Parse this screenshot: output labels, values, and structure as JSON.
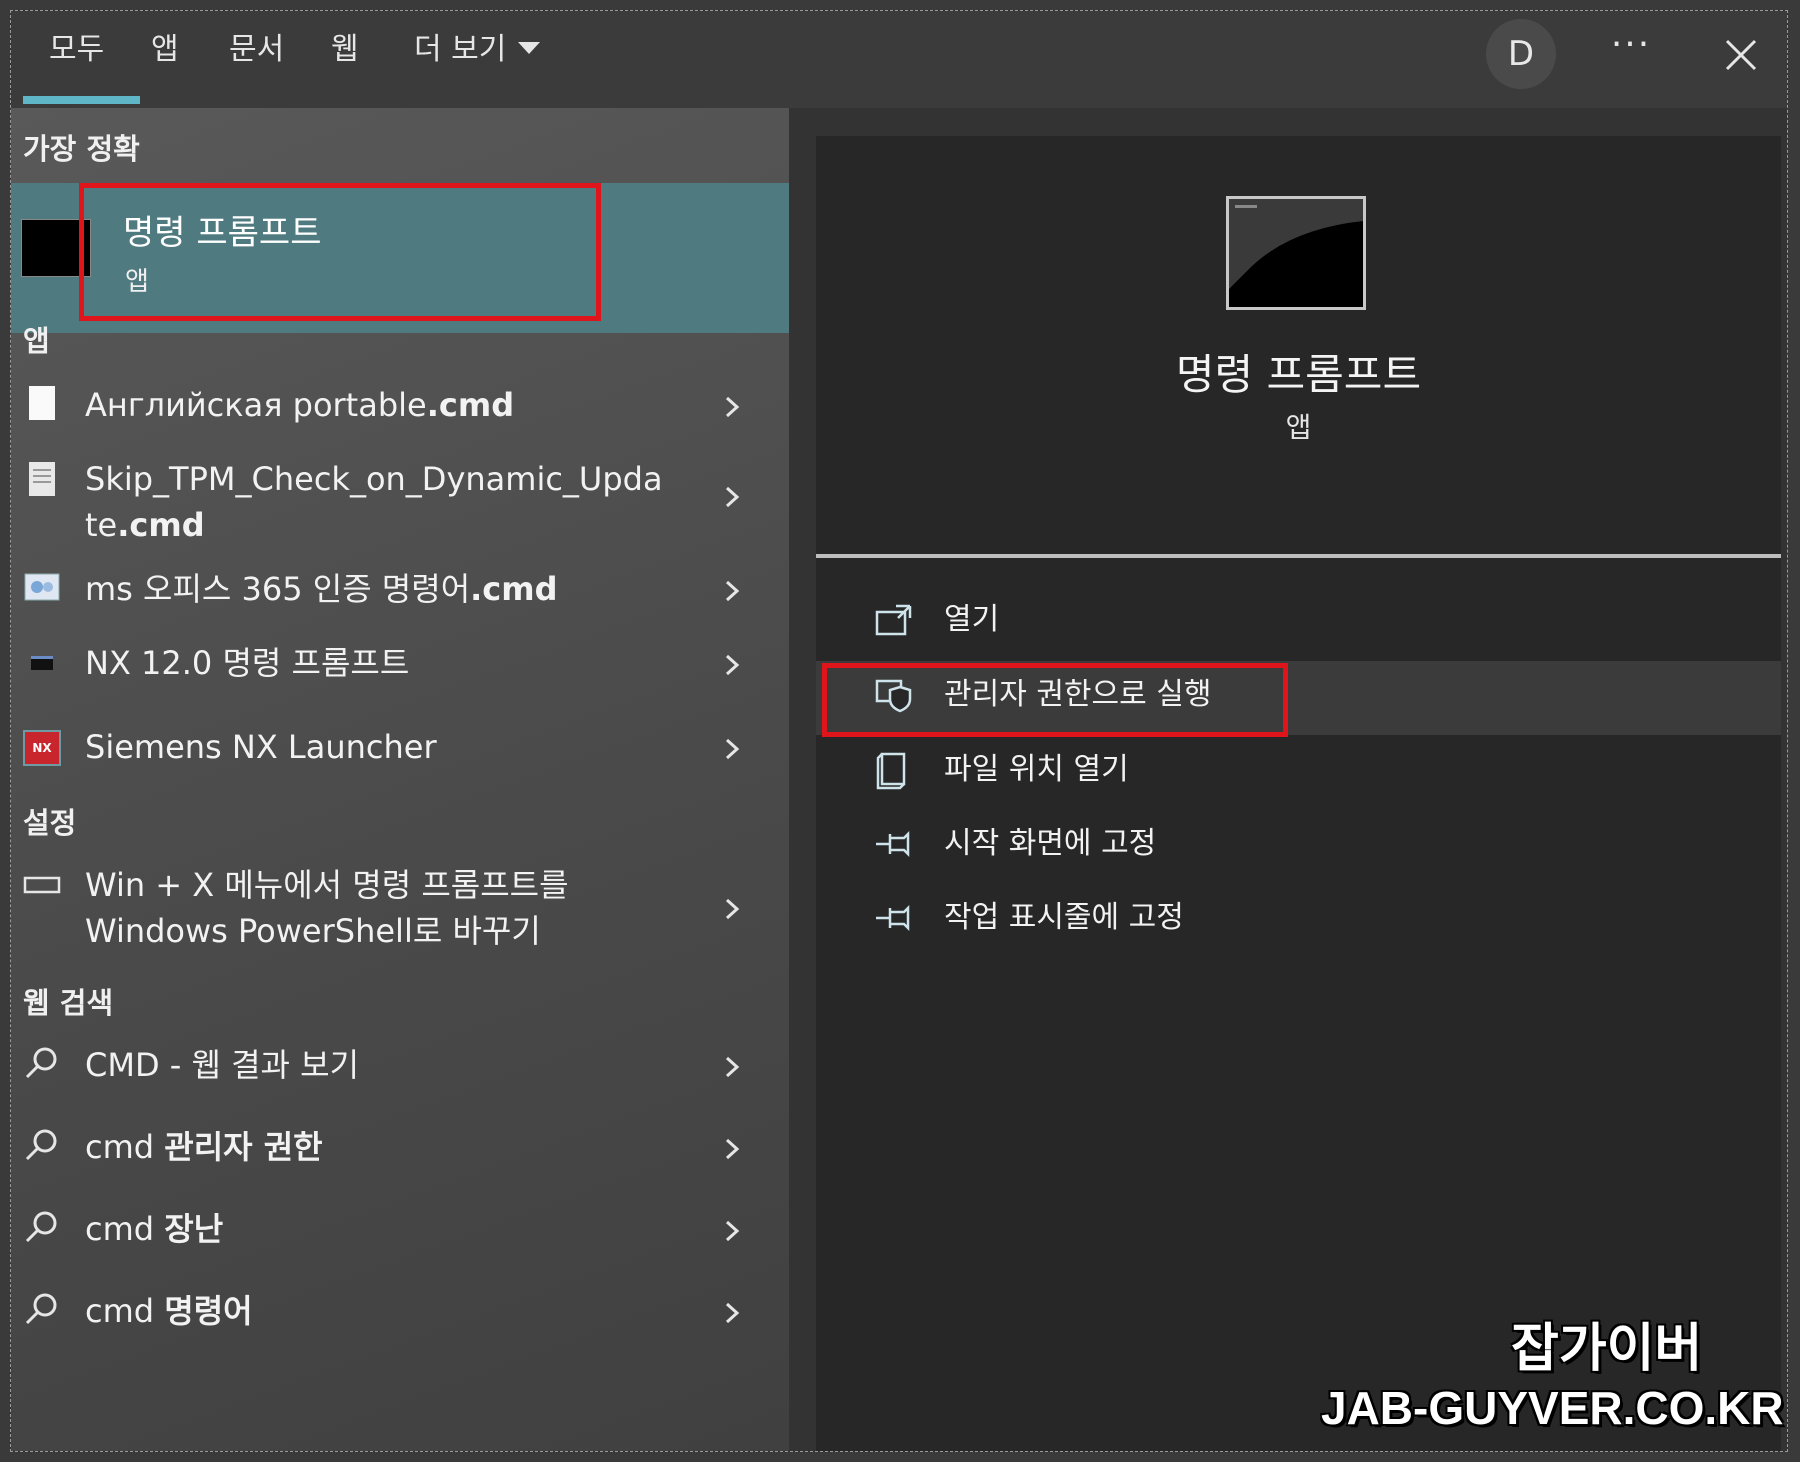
{
  "tabs": [
    {
      "label": "모두"
    },
    {
      "label": "앱"
    },
    {
      "label": "문서"
    },
    {
      "label": "웹"
    },
    {
      "label": "더 보기"
    }
  ],
  "header": {
    "avatar_letter": "D",
    "more_label": "···"
  },
  "sections": {
    "best_match": "가장 정확",
    "apps": "앱",
    "settings": "설정",
    "web": "웹 검색"
  },
  "best_match": {
    "title": "명령 프롬프트",
    "subtitle": "앱"
  },
  "apps": [
    {
      "name": "Английская portable",
      "ext": ".cmd"
    },
    {
      "name_line1": "Skip_TPM_Check_on_Dynamic_Upda",
      "name_line2": "te",
      "ext": ".cmd"
    },
    {
      "name": "ms 오피스 365 인증 명령어",
      "ext": ".cmd"
    },
    {
      "name": "NX 12.0 명령 프롬프트"
    },
    {
      "name": "Siemens NX Launcher",
      "icon_text": "NX"
    }
  ],
  "settings": [
    {
      "line1": "Win + X 메뉴에서 명령 프롬프트를",
      "line2": "Windows PowerShell로 바꾸기"
    }
  ],
  "web": [
    {
      "prefix": "CMD",
      "suffix": " - 웹 결과 보기"
    },
    {
      "prefix": "cmd ",
      "bold": "관리자 권한"
    },
    {
      "prefix": "cmd ",
      "bold": "장난"
    },
    {
      "prefix": "cmd ",
      "bold": "명령어"
    }
  ],
  "detail": {
    "title": "명령 프롬프트",
    "subtitle": "앱",
    "actions": [
      {
        "label": "열기",
        "icon": "open-icon"
      },
      {
        "label": "관리자 권한으로 실행",
        "icon": "shield-icon"
      },
      {
        "label": "파일 위치 열기",
        "icon": "file-location-icon"
      },
      {
        "label": "시작 화면에 고정",
        "icon": "pin-icon"
      },
      {
        "label": "작업 표시줄에 고정",
        "icon": "pin-icon"
      }
    ]
  },
  "watermark": {
    "line1": "잡가이버",
    "line2": "JAB-GUYVER.CO.KR"
  }
}
